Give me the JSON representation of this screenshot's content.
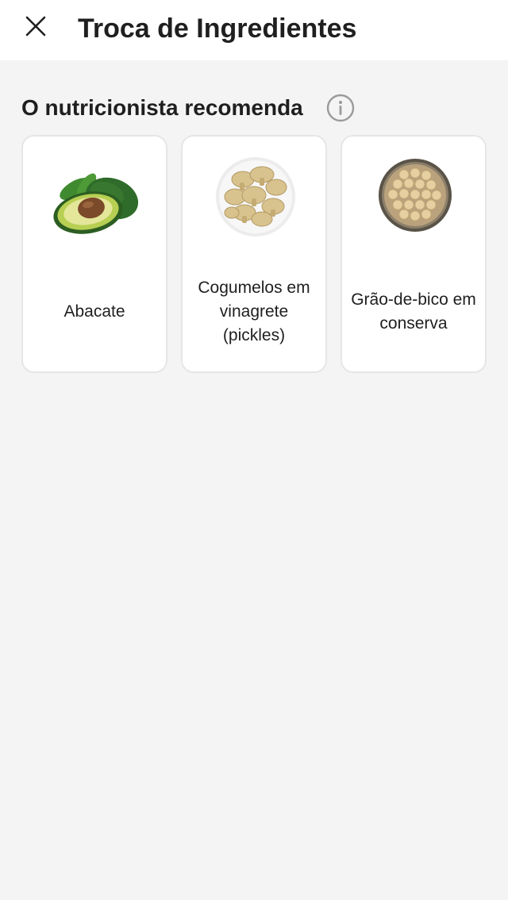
{
  "header": {
    "title": "Troca de Ingredientes"
  },
  "recommendation": {
    "title": "O nutricionista recomenda",
    "items": [
      {
        "label": "Abacate",
        "icon": "avocado-image"
      },
      {
        "label": "Cogumelos em vinagrete (pickles)",
        "icon": "pickled-mushrooms-image"
      },
      {
        "label": "Grão-de-bico em conserva",
        "icon": "canned-chickpeas-image"
      }
    ]
  },
  "colors": {
    "background": "#f4f4f4",
    "card": "#ffffff",
    "text": "#1f1f1f",
    "info_icon": "#9a9a9a"
  }
}
